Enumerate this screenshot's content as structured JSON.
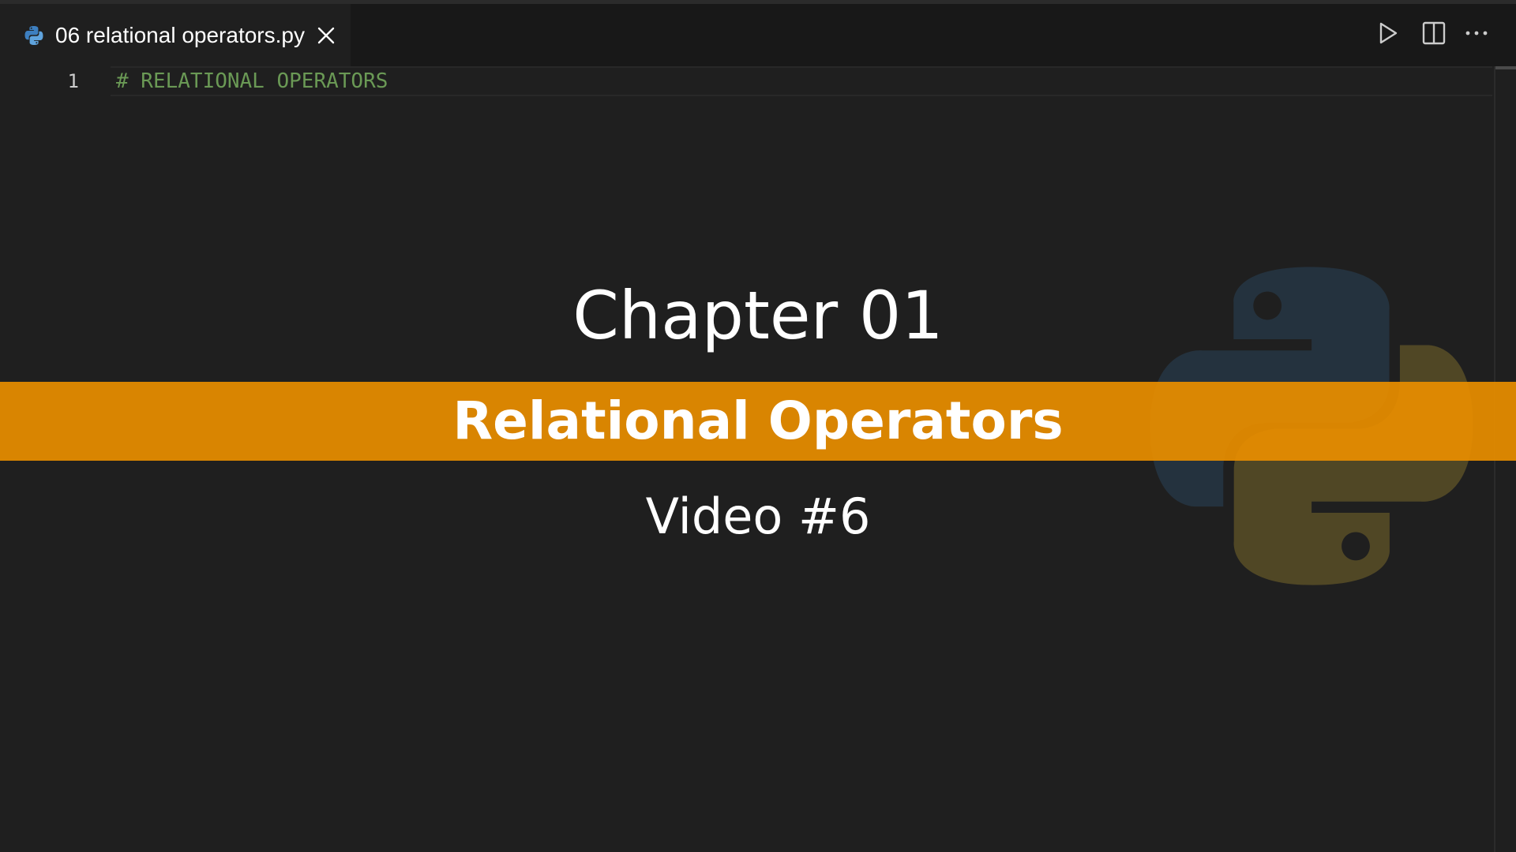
{
  "tab": {
    "filename": "06 relational operators.py",
    "icon": "python-file-icon"
  },
  "toolbar": {
    "run_icon": "play-icon",
    "split_icon": "split-editor-icon",
    "more_icon": "ellipsis-icon"
  },
  "editor": {
    "lines": [
      {
        "number": "1",
        "text": "# RELATIONAL OPERATORS"
      }
    ]
  },
  "overlay": {
    "chapter": "Chapter 01",
    "title": "Relational Operators",
    "video": "Video #6"
  },
  "colors": {
    "background": "#1f1f1f",
    "tabbar": "#181818",
    "comment": "#6a9955",
    "banner": "#e68c00",
    "python_blue": "#3776ab",
    "python_yellow": "#ffd43b"
  }
}
